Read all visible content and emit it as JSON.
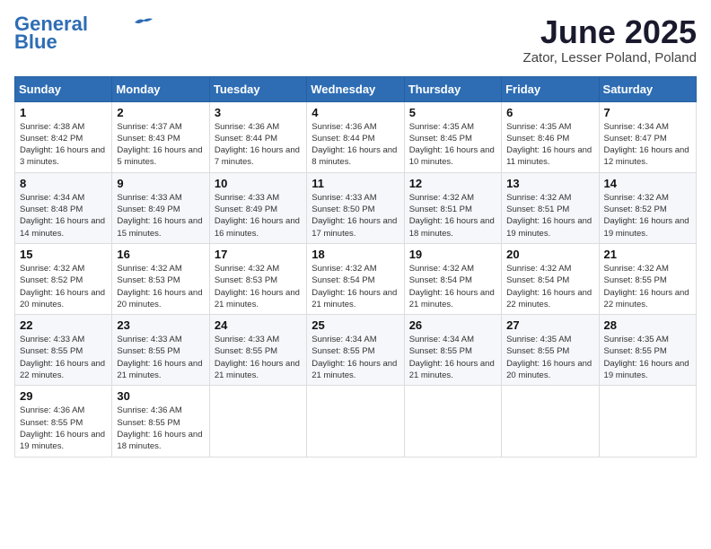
{
  "logo": {
    "line1": "General",
    "line2": "Blue"
  },
  "title": "June 2025",
  "location": "Zator, Lesser Poland, Poland",
  "weekdays": [
    "Sunday",
    "Monday",
    "Tuesday",
    "Wednesday",
    "Thursday",
    "Friday",
    "Saturday"
  ],
  "weeks": [
    [
      {
        "day": "1",
        "sunrise": "4:38 AM",
        "sunset": "8:42 PM",
        "daylight": "16 hours and 3 minutes."
      },
      {
        "day": "2",
        "sunrise": "4:37 AM",
        "sunset": "8:43 PM",
        "daylight": "16 hours and 5 minutes."
      },
      {
        "day": "3",
        "sunrise": "4:36 AM",
        "sunset": "8:44 PM",
        "daylight": "16 hours and 7 minutes."
      },
      {
        "day": "4",
        "sunrise": "4:36 AM",
        "sunset": "8:44 PM",
        "daylight": "16 hours and 8 minutes."
      },
      {
        "day": "5",
        "sunrise": "4:35 AM",
        "sunset": "8:45 PM",
        "daylight": "16 hours and 10 minutes."
      },
      {
        "day": "6",
        "sunrise": "4:35 AM",
        "sunset": "8:46 PM",
        "daylight": "16 hours and 11 minutes."
      },
      {
        "day": "7",
        "sunrise": "4:34 AM",
        "sunset": "8:47 PM",
        "daylight": "16 hours and 12 minutes."
      }
    ],
    [
      {
        "day": "8",
        "sunrise": "4:34 AM",
        "sunset": "8:48 PM",
        "daylight": "16 hours and 14 minutes."
      },
      {
        "day": "9",
        "sunrise": "4:33 AM",
        "sunset": "8:49 PM",
        "daylight": "16 hours and 15 minutes."
      },
      {
        "day": "10",
        "sunrise": "4:33 AM",
        "sunset": "8:49 PM",
        "daylight": "16 hours and 16 minutes."
      },
      {
        "day": "11",
        "sunrise": "4:33 AM",
        "sunset": "8:50 PM",
        "daylight": "16 hours and 17 minutes."
      },
      {
        "day": "12",
        "sunrise": "4:32 AM",
        "sunset": "8:51 PM",
        "daylight": "16 hours and 18 minutes."
      },
      {
        "day": "13",
        "sunrise": "4:32 AM",
        "sunset": "8:51 PM",
        "daylight": "16 hours and 19 minutes."
      },
      {
        "day": "14",
        "sunrise": "4:32 AM",
        "sunset": "8:52 PM",
        "daylight": "16 hours and 19 minutes."
      }
    ],
    [
      {
        "day": "15",
        "sunrise": "4:32 AM",
        "sunset": "8:52 PM",
        "daylight": "16 hours and 20 minutes."
      },
      {
        "day": "16",
        "sunrise": "4:32 AM",
        "sunset": "8:53 PM",
        "daylight": "16 hours and 20 minutes."
      },
      {
        "day": "17",
        "sunrise": "4:32 AM",
        "sunset": "8:53 PM",
        "daylight": "16 hours and 21 minutes."
      },
      {
        "day": "18",
        "sunrise": "4:32 AM",
        "sunset": "8:54 PM",
        "daylight": "16 hours and 21 minutes."
      },
      {
        "day": "19",
        "sunrise": "4:32 AM",
        "sunset": "8:54 PM",
        "daylight": "16 hours and 21 minutes."
      },
      {
        "day": "20",
        "sunrise": "4:32 AM",
        "sunset": "8:54 PM",
        "daylight": "16 hours and 22 minutes."
      },
      {
        "day": "21",
        "sunrise": "4:32 AM",
        "sunset": "8:55 PM",
        "daylight": "16 hours and 22 minutes."
      }
    ],
    [
      {
        "day": "22",
        "sunrise": "4:33 AM",
        "sunset": "8:55 PM",
        "daylight": "16 hours and 22 minutes."
      },
      {
        "day": "23",
        "sunrise": "4:33 AM",
        "sunset": "8:55 PM",
        "daylight": "16 hours and 21 minutes."
      },
      {
        "day": "24",
        "sunrise": "4:33 AM",
        "sunset": "8:55 PM",
        "daylight": "16 hours and 21 minutes."
      },
      {
        "day": "25",
        "sunrise": "4:34 AM",
        "sunset": "8:55 PM",
        "daylight": "16 hours and 21 minutes."
      },
      {
        "day": "26",
        "sunrise": "4:34 AM",
        "sunset": "8:55 PM",
        "daylight": "16 hours and 21 minutes."
      },
      {
        "day": "27",
        "sunrise": "4:35 AM",
        "sunset": "8:55 PM",
        "daylight": "16 hours and 20 minutes."
      },
      {
        "day": "28",
        "sunrise": "4:35 AM",
        "sunset": "8:55 PM",
        "daylight": "16 hours and 19 minutes."
      }
    ],
    [
      {
        "day": "29",
        "sunrise": "4:36 AM",
        "sunset": "8:55 PM",
        "daylight": "16 hours and 19 minutes."
      },
      {
        "day": "30",
        "sunrise": "4:36 AM",
        "sunset": "8:55 PM",
        "daylight": "16 hours and 18 minutes."
      },
      null,
      null,
      null,
      null,
      null
    ]
  ]
}
